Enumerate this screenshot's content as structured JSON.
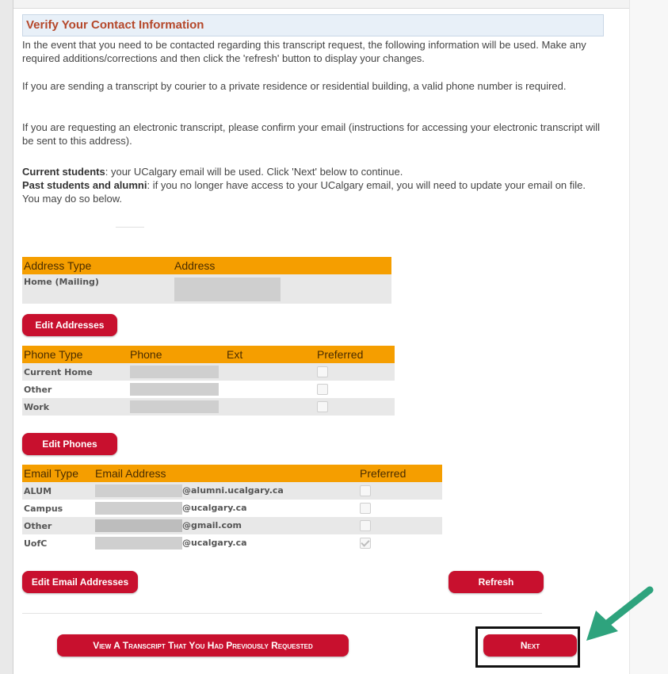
{
  "header": {
    "title": "Verify Your Contact Information"
  },
  "paragraphs": {
    "p1": "In the event that you need to be contacted regarding this transcript request, the following information will be used. Make any required additions/corrections and then click the 'refresh' button to display your changes.",
    "p2": "If you are sending a transcript by courier to a private residence or residential building, a valid phone number is required.",
    "p3": "If you are requesting an electronic transcript, please confirm your email (instructions for accessing your electronic transcript will be sent to this address).",
    "current_label": "Current students",
    "current_text": ": your UCalgary email will be used. Click 'Next' below to continue.",
    "past_label": "Past students and alumni",
    "past_text": ": if you no longer have access to your UCalgary email, you will need to update your email on file. You may do so below."
  },
  "address_table": {
    "headers": [
      "Address Type",
      "Address"
    ],
    "rows": [
      {
        "type": "Home (Mailing)"
      }
    ]
  },
  "phone_table": {
    "headers": [
      "Phone Type",
      "Phone",
      "Ext",
      "Preferred"
    ],
    "rows": [
      {
        "type": "Current Home",
        "preferred": false
      },
      {
        "type": "Other",
        "preferred": false
      },
      {
        "type": "Work",
        "preferred": false
      }
    ]
  },
  "email_table": {
    "headers": [
      "Email Type",
      "Email Address",
      "Preferred"
    ],
    "rows": [
      {
        "type": "ALUM",
        "domain": "@alumni.ucalgary.ca",
        "preferred": false
      },
      {
        "type": "Campus",
        "domain": "@ucalgary.ca",
        "preferred": false
      },
      {
        "type": "Other",
        "domain": "@gmail.com",
        "preferred": false
      },
      {
        "type": "UofC",
        "domain": "@ucalgary.ca",
        "preferred": true
      }
    ]
  },
  "buttons": {
    "edit_addresses": "Edit Addresses",
    "edit_phones": "Edit Phones",
    "edit_emails": "Edit Email Addresses",
    "refresh": "Refresh",
    "view_previous": "View A Transcript That You Had Previously Requested",
    "next": "Next"
  },
  "colors": {
    "accent_red": "#c8102e",
    "table_header": "#f59e00",
    "title_text": "#b5482b",
    "arrow": "#2ea37d"
  }
}
